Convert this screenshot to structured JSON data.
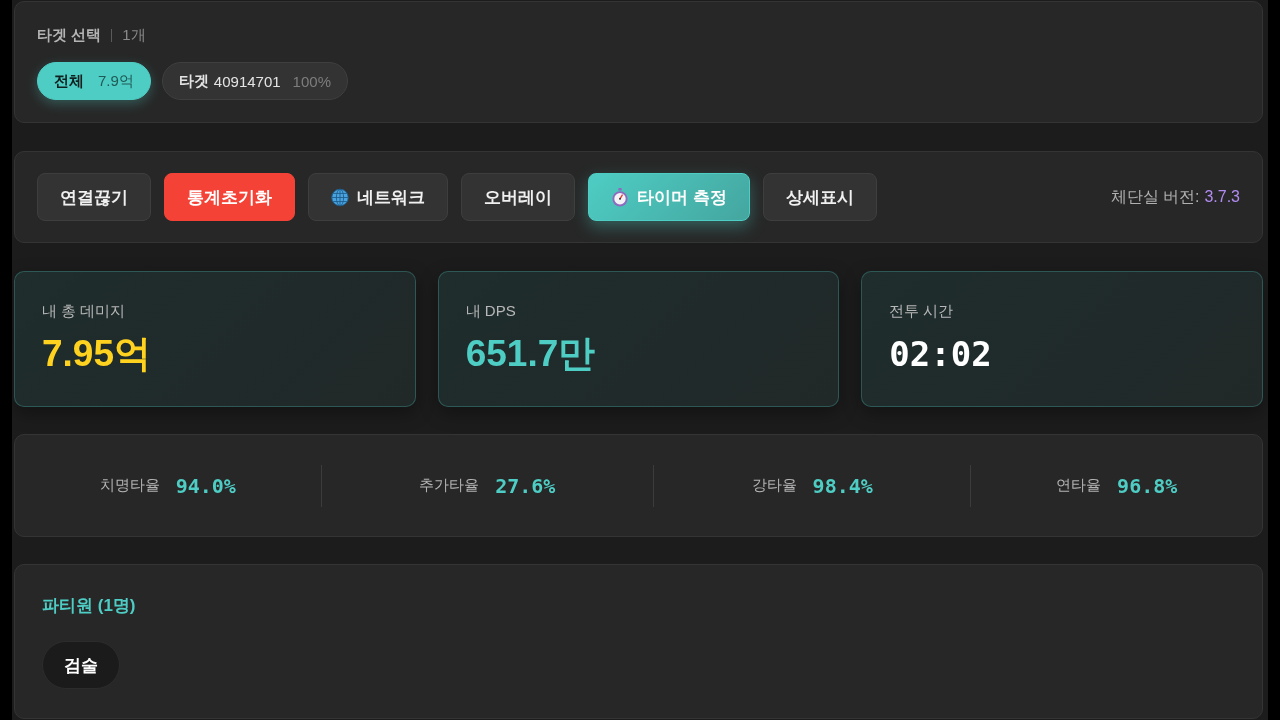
{
  "target_select": {
    "title": "타겟 선택",
    "count": "1개",
    "chips": [
      {
        "label": "전체",
        "value": "7.9억",
        "selected": true
      },
      {
        "label": "타겟",
        "name": "40914701",
        "value": "100%",
        "selected": false
      }
    ]
  },
  "toolbar": {
    "buttons": [
      {
        "label": "연결끊기",
        "kind": "plain"
      },
      {
        "label": "통계초기화",
        "kind": "danger"
      },
      {
        "label": "네트워크",
        "kind": "network"
      },
      {
        "label": "오버레이",
        "kind": "plain"
      },
      {
        "label": "타이머 측정",
        "kind": "timer"
      },
      {
        "label": "상세표시",
        "kind": "plain"
      }
    ],
    "version": {
      "label": "체단실 버전:",
      "value": "3.7.3"
    }
  },
  "stats": [
    {
      "label": "내 총 데미지",
      "value": "7.95억",
      "color": "#ffd21f",
      "kind": "amount"
    },
    {
      "label": "내 DPS",
      "value": "651.7만",
      "color": "#4ecdc4",
      "kind": "amount"
    },
    {
      "label": "전투 시간",
      "value": "02:02",
      "color": "#ffffff",
      "kind": "clock"
    }
  ],
  "rates": [
    {
      "label": "치명타율",
      "value": "94.0%"
    },
    {
      "label": "추가타율",
      "value": "27.6%"
    },
    {
      "label": "강타율",
      "value": "98.4%"
    },
    {
      "label": "연타율",
      "value": "96.8%"
    }
  ],
  "party": {
    "title": "파티원 (1명)",
    "members": [
      "검술"
    ]
  }
}
